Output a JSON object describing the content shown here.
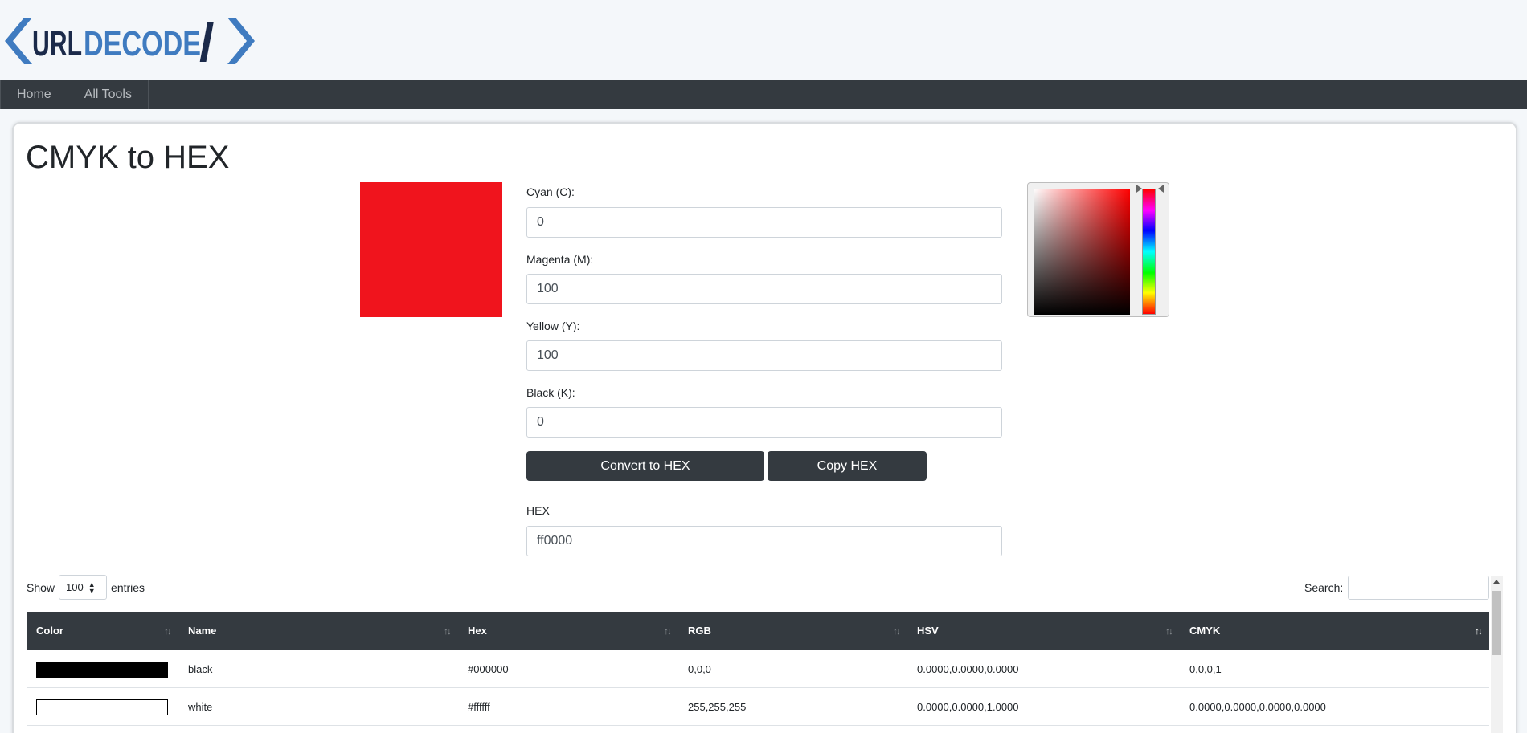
{
  "logo": {
    "part1": "URL",
    "part2": "DECODE",
    "slash": "/"
  },
  "nav": {
    "items": [
      "Home",
      "All Tools"
    ]
  },
  "page": {
    "title": "CMYK to HEX"
  },
  "preview": {
    "color": "#f0141d"
  },
  "form": {
    "cyan_label": "Cyan (C):",
    "cyan_value": "0",
    "magenta_label": "Magenta (M):",
    "magenta_value": "100",
    "yellow_label": "Yellow (Y):",
    "yellow_value": "100",
    "black_label": "Black (K):",
    "black_value": "0",
    "convert_button": "Convert to HEX",
    "copy_button": "Copy HEX",
    "hex_label": "HEX",
    "hex_value": "ff0000"
  },
  "table_controls": {
    "show_label": "Show",
    "entries_label": "entries",
    "page_size": "100",
    "search_label": "Search:"
  },
  "table": {
    "columns": [
      "Color",
      "Name",
      "Hex",
      "RGB",
      "HSV",
      "CMYK"
    ],
    "rows": [
      {
        "swatch": "#000000",
        "name": "black",
        "hex": "#000000",
        "rgb": "0,0,0",
        "hsv": "0.0000,0.0000,0.0000",
        "cmyk": "0,0,0,1"
      },
      {
        "swatch": "#ffffff",
        "name": "white",
        "hex": "#ffffff",
        "rgb": "255,255,255",
        "hsv": "0.0000,0.0000,1.0000",
        "cmyk": "0.0000,0.0000,0.0000,0.0000"
      }
    ]
  }
}
